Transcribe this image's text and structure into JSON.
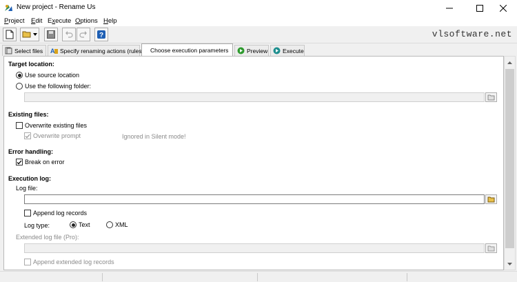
{
  "window": {
    "title": "New project - Rename Us",
    "brand": "vlsoftware.net"
  },
  "menu": [
    {
      "pre": "",
      "ul": "P",
      "post": "roject"
    },
    {
      "pre": "",
      "ul": "E",
      "post": "dit"
    },
    {
      "pre": "E",
      "ul": "x",
      "post": "ecute"
    },
    {
      "pre": "",
      "ul": "O",
      "post": "ptions"
    },
    {
      "pre": "",
      "ul": "H",
      "post": "elp"
    }
  ],
  "toolbar": {
    "icons": [
      "new-file-icon",
      "open-folder-icon",
      "dropdown-arrow-icon",
      "save-icon",
      "undo-icon",
      "redo-icon",
      "help-icon"
    ]
  },
  "tabs": [
    {
      "label": "Select files",
      "icon": "select-files-icon"
    },
    {
      "label": "Specify renaming actions (rules)",
      "icon": "rules-icon"
    },
    {
      "label": "Choose execution parameters",
      "icon": ""
    },
    {
      "label": "Preview",
      "icon": "play-green-icon"
    },
    {
      "label": "Execute",
      "icon": "play-teal-icon"
    }
  ],
  "target": {
    "heading": "Target location:",
    "use_source": "Use source location",
    "use_folder": "Use the following folder:",
    "folder_value": ""
  },
  "existing": {
    "heading": "Existing files:",
    "overwrite": "Overwrite existing files",
    "overwrite_prompt": "Overwrite prompt",
    "silent_note": "Ignored in Silent mode!"
  },
  "errors": {
    "heading": "Error handling:",
    "break_on_error": "Break on error"
  },
  "log": {
    "heading": "Execution log:",
    "log_file_label": "Log file:",
    "log_file_value": "",
    "append": "Append log records",
    "type_label": "Log type:",
    "type_text": "Text",
    "type_xml": "XML",
    "extended_label": "Extended log file (Pro):",
    "extended_value": "",
    "append_extended": "Append extended log records"
  },
  "colors": {
    "accent_blue": "#1e5fb4",
    "play_green": "#2e9a2e",
    "play_teal": "#1d8e8e"
  }
}
